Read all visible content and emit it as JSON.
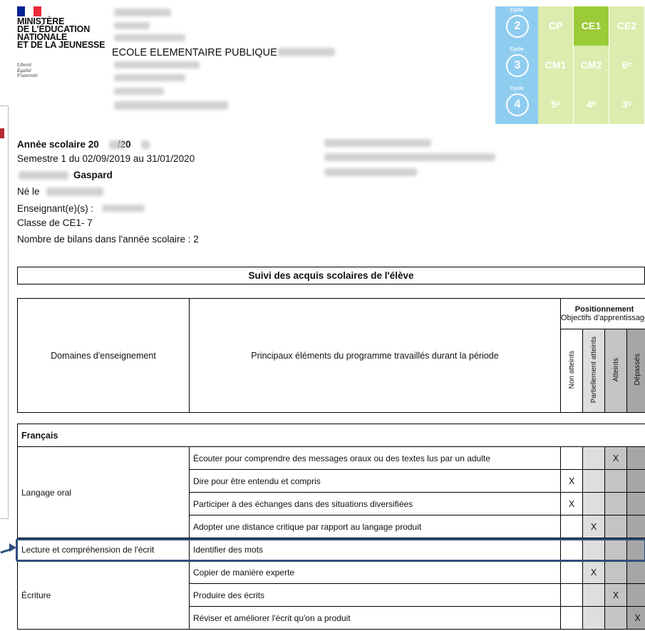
{
  "header": {
    "ministry_lines": [
      "MINISTÈRE",
      "DE L'ÉDUCATION",
      "NATIONALE",
      "ET DE LA JEUNESSE"
    ],
    "motto_lines": [
      "Liberté",
      "Égalité",
      "Fraternité"
    ],
    "school_name": "ECOLE ELEMENTAIRE PUBLIQUE",
    "flag_colors": [
      "#002395",
      "#ffffff",
      "#ed2939"
    ]
  },
  "cycles": {
    "label": "Cycle",
    "rows": [
      {
        "cycle": "2",
        "levels": [
          "CP",
          "CE1",
          "CE2"
        ]
      },
      {
        "cycle": "3",
        "levels": [
          "CM1",
          "CM2",
          "6ᵉ"
        ]
      },
      {
        "cycle": "4",
        "levels": [
          "5ᵉ",
          "4ᵉ",
          "3ᵉ"
        ]
      }
    ],
    "active_level": "CE1"
  },
  "student": {
    "year_label": "Année scolaire 20",
    "year_sep": "/20",
    "semester": "Semestre 1 du 02/09/2019 au 31/01/2020",
    "first_name": "Gaspard",
    "born_label": "Né le",
    "teacher_label": "Enseignant(e)(s) :",
    "class": "Classe de CE1- 7",
    "bilans": "Nombre de bilans dans l'année scolaire : 2"
  },
  "table": {
    "title": "Suivi des acquis scolaires de l'élève",
    "headers": {
      "domains": "Domaines d'enseignement",
      "elements": "Principaux éléments du programme travaillés durant la période",
      "positioning": "Positionnement",
      "objectives": "Objectifs d'apprentissage",
      "levels": [
        "Non atteints",
        "Partiellement atteints",
        "Atteints",
        "Dépassés"
      ]
    },
    "subject": "Français",
    "domains": [
      {
        "name": "Langage oral",
        "items": [
          {
            "text": "Écouter pour comprendre des messages oraux ou des textes lus par un adulte",
            "mark": 2
          },
          {
            "text": "Dire pour être entendu et compris",
            "mark": 0
          },
          {
            "text": "Participer à des échanges dans des situations diversifiées",
            "mark": 0
          },
          {
            "text": "Adopter une distance critique par rapport au langage produit",
            "mark": 1
          }
        ]
      },
      {
        "name": "Lecture et compréhension de l'écrit",
        "items": [
          {
            "text": "Identifier des mots",
            "mark": -1
          }
        ]
      },
      {
        "name": "Écriture",
        "items": [
          {
            "text": "Copier de manière experte",
            "mark": 1
          },
          {
            "text": "Produire des écrits",
            "mark": 2
          },
          {
            "text": "Réviser et améliorer l'écrit qu'on a produit",
            "mark": 3
          }
        ]
      }
    ],
    "mark_symbol": "X"
  }
}
